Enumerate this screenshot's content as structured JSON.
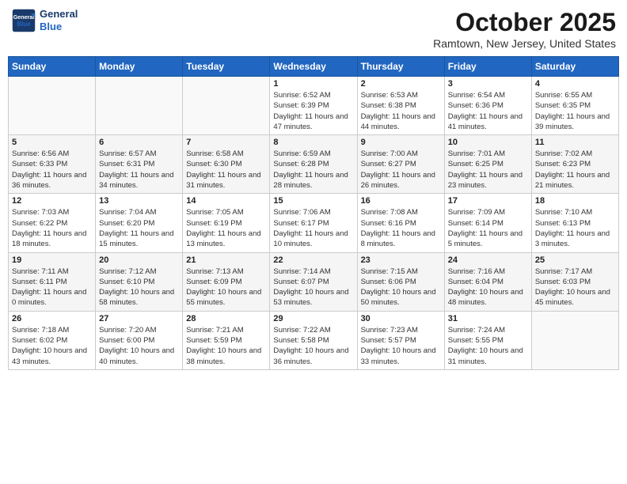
{
  "header": {
    "logo_line1": "General",
    "logo_line2": "Blue",
    "month": "October 2025",
    "location": "Ramtown, New Jersey, United States"
  },
  "days_of_week": [
    "Sunday",
    "Monday",
    "Tuesday",
    "Wednesday",
    "Thursday",
    "Friday",
    "Saturday"
  ],
  "weeks": [
    [
      {
        "day": "",
        "info": ""
      },
      {
        "day": "",
        "info": ""
      },
      {
        "day": "",
        "info": ""
      },
      {
        "day": "1",
        "info": "Sunrise: 6:52 AM\nSunset: 6:39 PM\nDaylight: 11 hours and 47 minutes."
      },
      {
        "day": "2",
        "info": "Sunrise: 6:53 AM\nSunset: 6:38 PM\nDaylight: 11 hours and 44 minutes."
      },
      {
        "day": "3",
        "info": "Sunrise: 6:54 AM\nSunset: 6:36 PM\nDaylight: 11 hours and 41 minutes."
      },
      {
        "day": "4",
        "info": "Sunrise: 6:55 AM\nSunset: 6:35 PM\nDaylight: 11 hours and 39 minutes."
      }
    ],
    [
      {
        "day": "5",
        "info": "Sunrise: 6:56 AM\nSunset: 6:33 PM\nDaylight: 11 hours and 36 minutes."
      },
      {
        "day": "6",
        "info": "Sunrise: 6:57 AM\nSunset: 6:31 PM\nDaylight: 11 hours and 34 minutes."
      },
      {
        "day": "7",
        "info": "Sunrise: 6:58 AM\nSunset: 6:30 PM\nDaylight: 11 hours and 31 minutes."
      },
      {
        "day": "8",
        "info": "Sunrise: 6:59 AM\nSunset: 6:28 PM\nDaylight: 11 hours and 28 minutes."
      },
      {
        "day": "9",
        "info": "Sunrise: 7:00 AM\nSunset: 6:27 PM\nDaylight: 11 hours and 26 minutes."
      },
      {
        "day": "10",
        "info": "Sunrise: 7:01 AM\nSunset: 6:25 PM\nDaylight: 11 hours and 23 minutes."
      },
      {
        "day": "11",
        "info": "Sunrise: 7:02 AM\nSunset: 6:23 PM\nDaylight: 11 hours and 21 minutes."
      }
    ],
    [
      {
        "day": "12",
        "info": "Sunrise: 7:03 AM\nSunset: 6:22 PM\nDaylight: 11 hours and 18 minutes."
      },
      {
        "day": "13",
        "info": "Sunrise: 7:04 AM\nSunset: 6:20 PM\nDaylight: 11 hours and 15 minutes."
      },
      {
        "day": "14",
        "info": "Sunrise: 7:05 AM\nSunset: 6:19 PM\nDaylight: 11 hours and 13 minutes."
      },
      {
        "day": "15",
        "info": "Sunrise: 7:06 AM\nSunset: 6:17 PM\nDaylight: 11 hours and 10 minutes."
      },
      {
        "day": "16",
        "info": "Sunrise: 7:08 AM\nSunset: 6:16 PM\nDaylight: 11 hours and 8 minutes."
      },
      {
        "day": "17",
        "info": "Sunrise: 7:09 AM\nSunset: 6:14 PM\nDaylight: 11 hours and 5 minutes."
      },
      {
        "day": "18",
        "info": "Sunrise: 7:10 AM\nSunset: 6:13 PM\nDaylight: 11 hours and 3 minutes."
      }
    ],
    [
      {
        "day": "19",
        "info": "Sunrise: 7:11 AM\nSunset: 6:11 PM\nDaylight: 11 hours and 0 minutes."
      },
      {
        "day": "20",
        "info": "Sunrise: 7:12 AM\nSunset: 6:10 PM\nDaylight: 10 hours and 58 minutes."
      },
      {
        "day": "21",
        "info": "Sunrise: 7:13 AM\nSunset: 6:09 PM\nDaylight: 10 hours and 55 minutes."
      },
      {
        "day": "22",
        "info": "Sunrise: 7:14 AM\nSunset: 6:07 PM\nDaylight: 10 hours and 53 minutes."
      },
      {
        "day": "23",
        "info": "Sunrise: 7:15 AM\nSunset: 6:06 PM\nDaylight: 10 hours and 50 minutes."
      },
      {
        "day": "24",
        "info": "Sunrise: 7:16 AM\nSunset: 6:04 PM\nDaylight: 10 hours and 48 minutes."
      },
      {
        "day": "25",
        "info": "Sunrise: 7:17 AM\nSunset: 6:03 PM\nDaylight: 10 hours and 45 minutes."
      }
    ],
    [
      {
        "day": "26",
        "info": "Sunrise: 7:18 AM\nSunset: 6:02 PM\nDaylight: 10 hours and 43 minutes."
      },
      {
        "day": "27",
        "info": "Sunrise: 7:20 AM\nSunset: 6:00 PM\nDaylight: 10 hours and 40 minutes."
      },
      {
        "day": "28",
        "info": "Sunrise: 7:21 AM\nSunset: 5:59 PM\nDaylight: 10 hours and 38 minutes."
      },
      {
        "day": "29",
        "info": "Sunrise: 7:22 AM\nSunset: 5:58 PM\nDaylight: 10 hours and 36 minutes."
      },
      {
        "day": "30",
        "info": "Sunrise: 7:23 AM\nSunset: 5:57 PM\nDaylight: 10 hours and 33 minutes."
      },
      {
        "day": "31",
        "info": "Sunrise: 7:24 AM\nSunset: 5:55 PM\nDaylight: 10 hours and 31 minutes."
      },
      {
        "day": "",
        "info": ""
      }
    ]
  ]
}
